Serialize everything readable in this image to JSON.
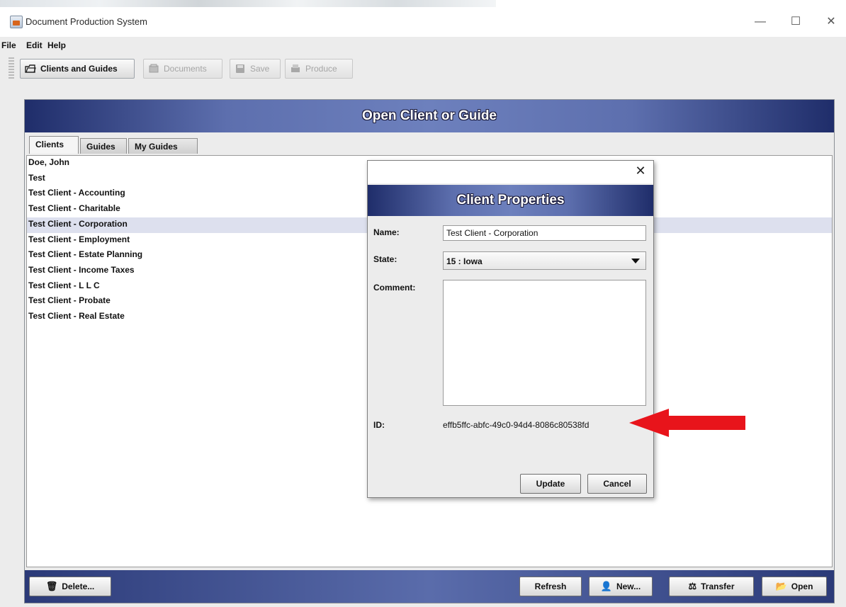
{
  "window": {
    "title": "Document Production System",
    "minimize_glyph": "—",
    "maximize_glyph": "☐",
    "close_glyph": "✕"
  },
  "menu": {
    "file": "File",
    "edit": "Edit",
    "help": "Help"
  },
  "toolbar": {
    "clients_and_guides": "Clients and Guides",
    "documents": "Documents",
    "save": "Save",
    "produce": "Produce"
  },
  "panel": {
    "title": "Open Client or Guide",
    "tabs": [
      "Clients",
      "Guides",
      "My Guides"
    ],
    "active_tab": "Clients",
    "clients": [
      "Doe, John",
      "Test",
      "Test Client - Accounting",
      "Test Client - Charitable",
      "Test Client - Corporation",
      "Test Client - Employment",
      "Test Client - Estate Planning",
      "Test Client - Income Taxes",
      "Test Client - L L C",
      "Test Client - Probate",
      "Test Client - Real Estate"
    ],
    "selected_client": "Test Client - Corporation"
  },
  "footer": {
    "delete": "Delete...",
    "refresh": "Refresh",
    "new": "New...",
    "transfer": "Transfer",
    "open": "Open"
  },
  "dialog": {
    "close_glyph": "✕",
    "title": "Client Properties",
    "name_label": "Name:",
    "name_value": "Test Client - Corporation",
    "state_label": "State:",
    "state_value": "15 : Iowa",
    "comment_label": "Comment:",
    "comment_value": "",
    "id_label": "ID:",
    "id_value": "effb5ffc-abfc-49c0-94d4-8086c80538fd",
    "update": "Update",
    "cancel": "Cancel"
  },
  "colors": {
    "header_dark": "#1f2d6a",
    "header_light": "#6d80bd",
    "selection": "#dde0ee",
    "annotation_arrow": "#e8141b"
  },
  "icons": [
    "app-icon",
    "open-folder-icon",
    "documents-icon",
    "save-disk-icon",
    "produce-icon",
    "trash-icon",
    "new-person-icon",
    "transfer-icon",
    "open-icon"
  ]
}
